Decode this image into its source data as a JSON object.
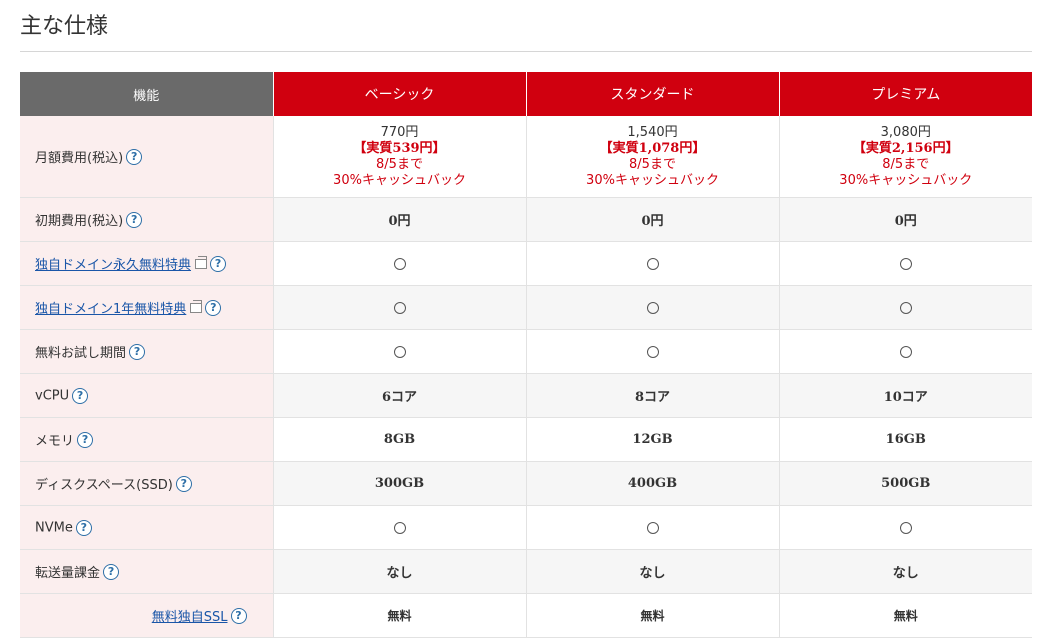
{
  "page": {
    "title": "主な仕様"
  },
  "table": {
    "header": {
      "feature": "機能",
      "plans": [
        "ベーシック",
        "スタンダード",
        "プレミアム"
      ]
    },
    "price_row": {
      "label": "月額費用(税込)",
      "plans": [
        {
          "base": "770円",
          "real": "【実質539円】",
          "until": "8/5まで",
          "cashback": "30%キャッシュバック"
        },
        {
          "base": "1,540円",
          "real": "【実質1,078円】",
          "until": "8/5まで",
          "cashback": "30%キャッシュバック"
        },
        {
          "base": "3,080円",
          "real": "【実質2,156円】",
          "until": "8/5まで",
          "cashback": "30%キャッシュバック"
        }
      ]
    },
    "rows": [
      {
        "label": "初期費用(税込)",
        "link": false,
        "values": [
          "0円",
          "0円",
          "0円"
        ]
      },
      {
        "label": "独自ドメイン永久無料特典",
        "link": true,
        "values": [
          "○",
          "○",
          "○"
        ]
      },
      {
        "label": "独自ドメイン1年無料特典",
        "link": true,
        "values": [
          "○",
          "○",
          "○"
        ]
      },
      {
        "label": "無料お試し期間",
        "link": false,
        "values": [
          "○",
          "○",
          "○"
        ]
      },
      {
        "label": "vCPU",
        "link": false,
        "values": [
          "6コア",
          "8コア",
          "10コア"
        ]
      },
      {
        "label": "メモリ",
        "link": false,
        "values": [
          "8GB",
          "12GB",
          "16GB"
        ]
      },
      {
        "label": "ディスクスペース(SSD)",
        "link": false,
        "values": [
          "300GB",
          "400GB",
          "500GB"
        ]
      },
      {
        "label": "NVMe",
        "link": false,
        "values": [
          "○",
          "○",
          "○"
        ]
      },
      {
        "label": "転送量課金",
        "link": false,
        "values": [
          "なし",
          "なし",
          "なし"
        ]
      }
    ],
    "ssl_row": {
      "label": "無料独自SSL",
      "values": [
        "無料",
        "無料",
        "無料"
      ]
    },
    "help_glyph": "?"
  }
}
